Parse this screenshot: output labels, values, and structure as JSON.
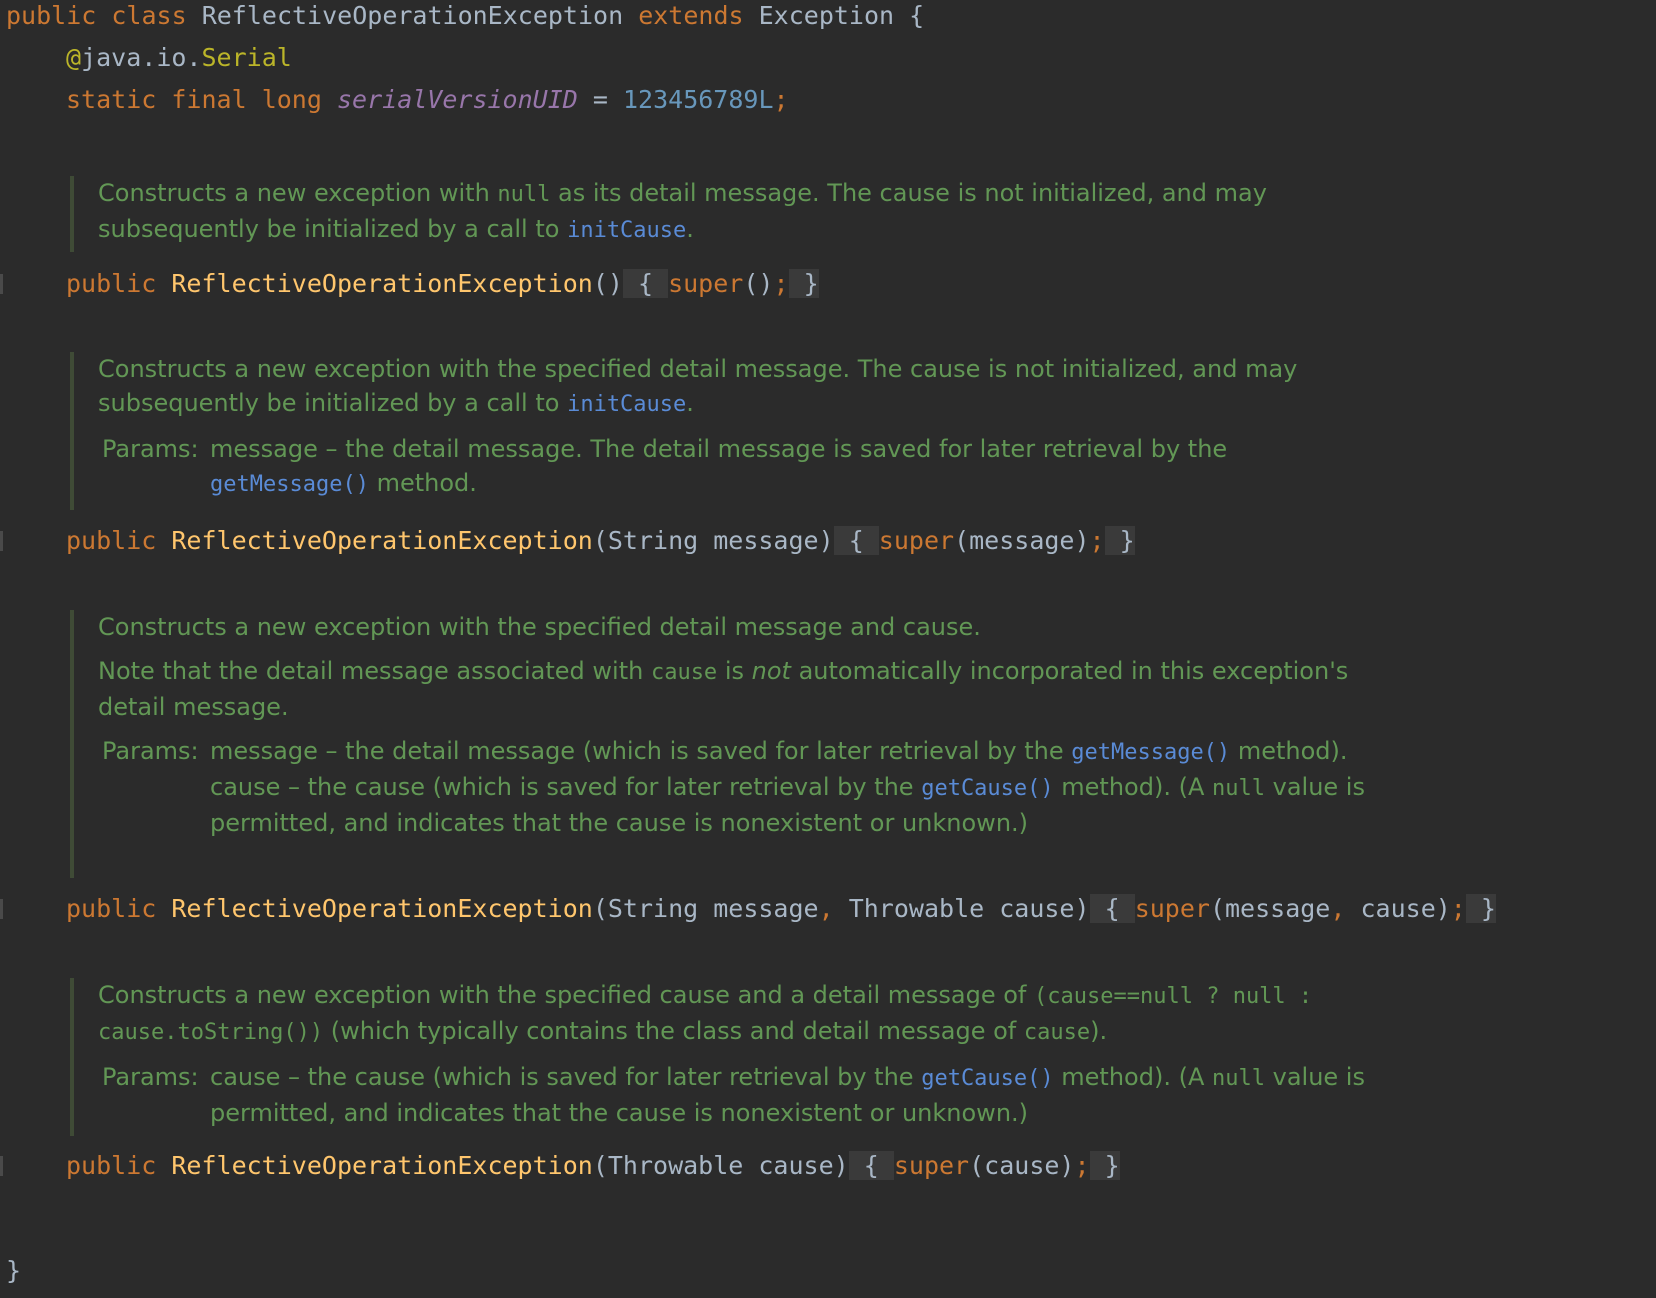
{
  "code": {
    "class_decl": {
      "kw_public": "public",
      "kw_class": "class",
      "name": "ReflectiveOperationException",
      "kw_extends": "extends",
      "super": "Exception",
      "brace": "{"
    },
    "annotation": {
      "at": "@",
      "pkg": "java.io.",
      "name": "Serial"
    },
    "field": {
      "kw_static": "static",
      "kw_final": "final",
      "kw_long": "long",
      "name": "serialVersionUID",
      "eq": "=",
      "value": "123456789L",
      "semi": ";"
    },
    "ctor1": {
      "kw_public": "public",
      "name": "ReflectiveOperationException",
      "params": "()",
      "open": " { ",
      "super": "super",
      "args": "()",
      "semi": ";",
      "close": " }"
    },
    "ctor2": {
      "kw_public": "public",
      "name": "ReflectiveOperationException",
      "params": "(String message)",
      "open": " { ",
      "super": "super",
      "args": "(message)",
      "semi": ";",
      "close": " }"
    },
    "ctor3": {
      "kw_public": "public",
      "name": "ReflectiveOperationException",
      "p_open": "(String message",
      "comma": ",",
      "p_rest": " Throwable cause)",
      "open": " { ",
      "super": "super",
      "a_open": "(message",
      "a_comma": ",",
      "a_rest": " cause)",
      "semi": ";",
      "close": " }"
    },
    "ctor4": {
      "kw_public": "public",
      "name": "ReflectiveOperationException",
      "params": "(Throwable cause)",
      "open": " { ",
      "super": "super",
      "args": "(cause)",
      "semi": ";",
      "close": " }"
    },
    "closing_brace": "}"
  },
  "docs": {
    "doc1": {
      "t1": "Constructs a new exception with ",
      "null": "null",
      "t2": " as its detail message. The cause is not initialized, and may subsequently be initialized by a call to ",
      "link": "initCause",
      "t3": "."
    },
    "doc2": {
      "t1": "Constructs a new exception with the specified detail message. The cause is not initialized, and may subsequently be initialized by a call to ",
      "link": "initCause",
      "t2": ".",
      "params_label": "Params:",
      "p1": "message – the detail message. The detail message is saved for later retrieval by the ",
      "p1_link": "getMessage()",
      "p1_end": " method."
    },
    "doc3": {
      "t1": "Constructs a new exception with the specified detail message and cause.",
      "n1": "Note that the detail message associated with ",
      "n_cause": "cause",
      "n2": " is ",
      "n_not": "not",
      "n3": " automatically incorporated in this exception's detail message.",
      "params_label": "Params:",
      "p1": "message – the detail message (which is saved for later retrieval by the ",
      "p1_link": "getMessage()",
      "p1_end": " method).",
      "p2": "cause – the cause (which is saved for later retrieval by the ",
      "p2_link": "getCause()",
      "p2_mid": " method). (A ",
      "p2_null": "null",
      "p2_end": " value is permitted, and indicates that the cause is nonexistent or unknown.)"
    },
    "doc4": {
      "t1": "Constructs a new exception with the specified cause and a detail message of ",
      "code": "(cause==null ? null : cause.toString())",
      "t2": " (which typically contains the class and detail message of ",
      "cause": "cause",
      "t3": ").",
      "params_label": "Params:",
      "p1": "cause – the cause (which is saved for later retrieval by the ",
      "p1_link": "getCause()",
      "p1_mid": " method). (A ",
      "p1_null": "null",
      "p1_end": " value is permitted, and indicates that the cause is nonexistent or unknown.)"
    }
  },
  "colors": {
    "background": "#2b2b2b",
    "keyword": "#cc7832",
    "method": "#ffc66d",
    "doc_text": "#629755",
    "doc_link": "#5a8bd6",
    "number": "#6897bb",
    "field": "#9876aa",
    "annotation": "#bbb529"
  }
}
